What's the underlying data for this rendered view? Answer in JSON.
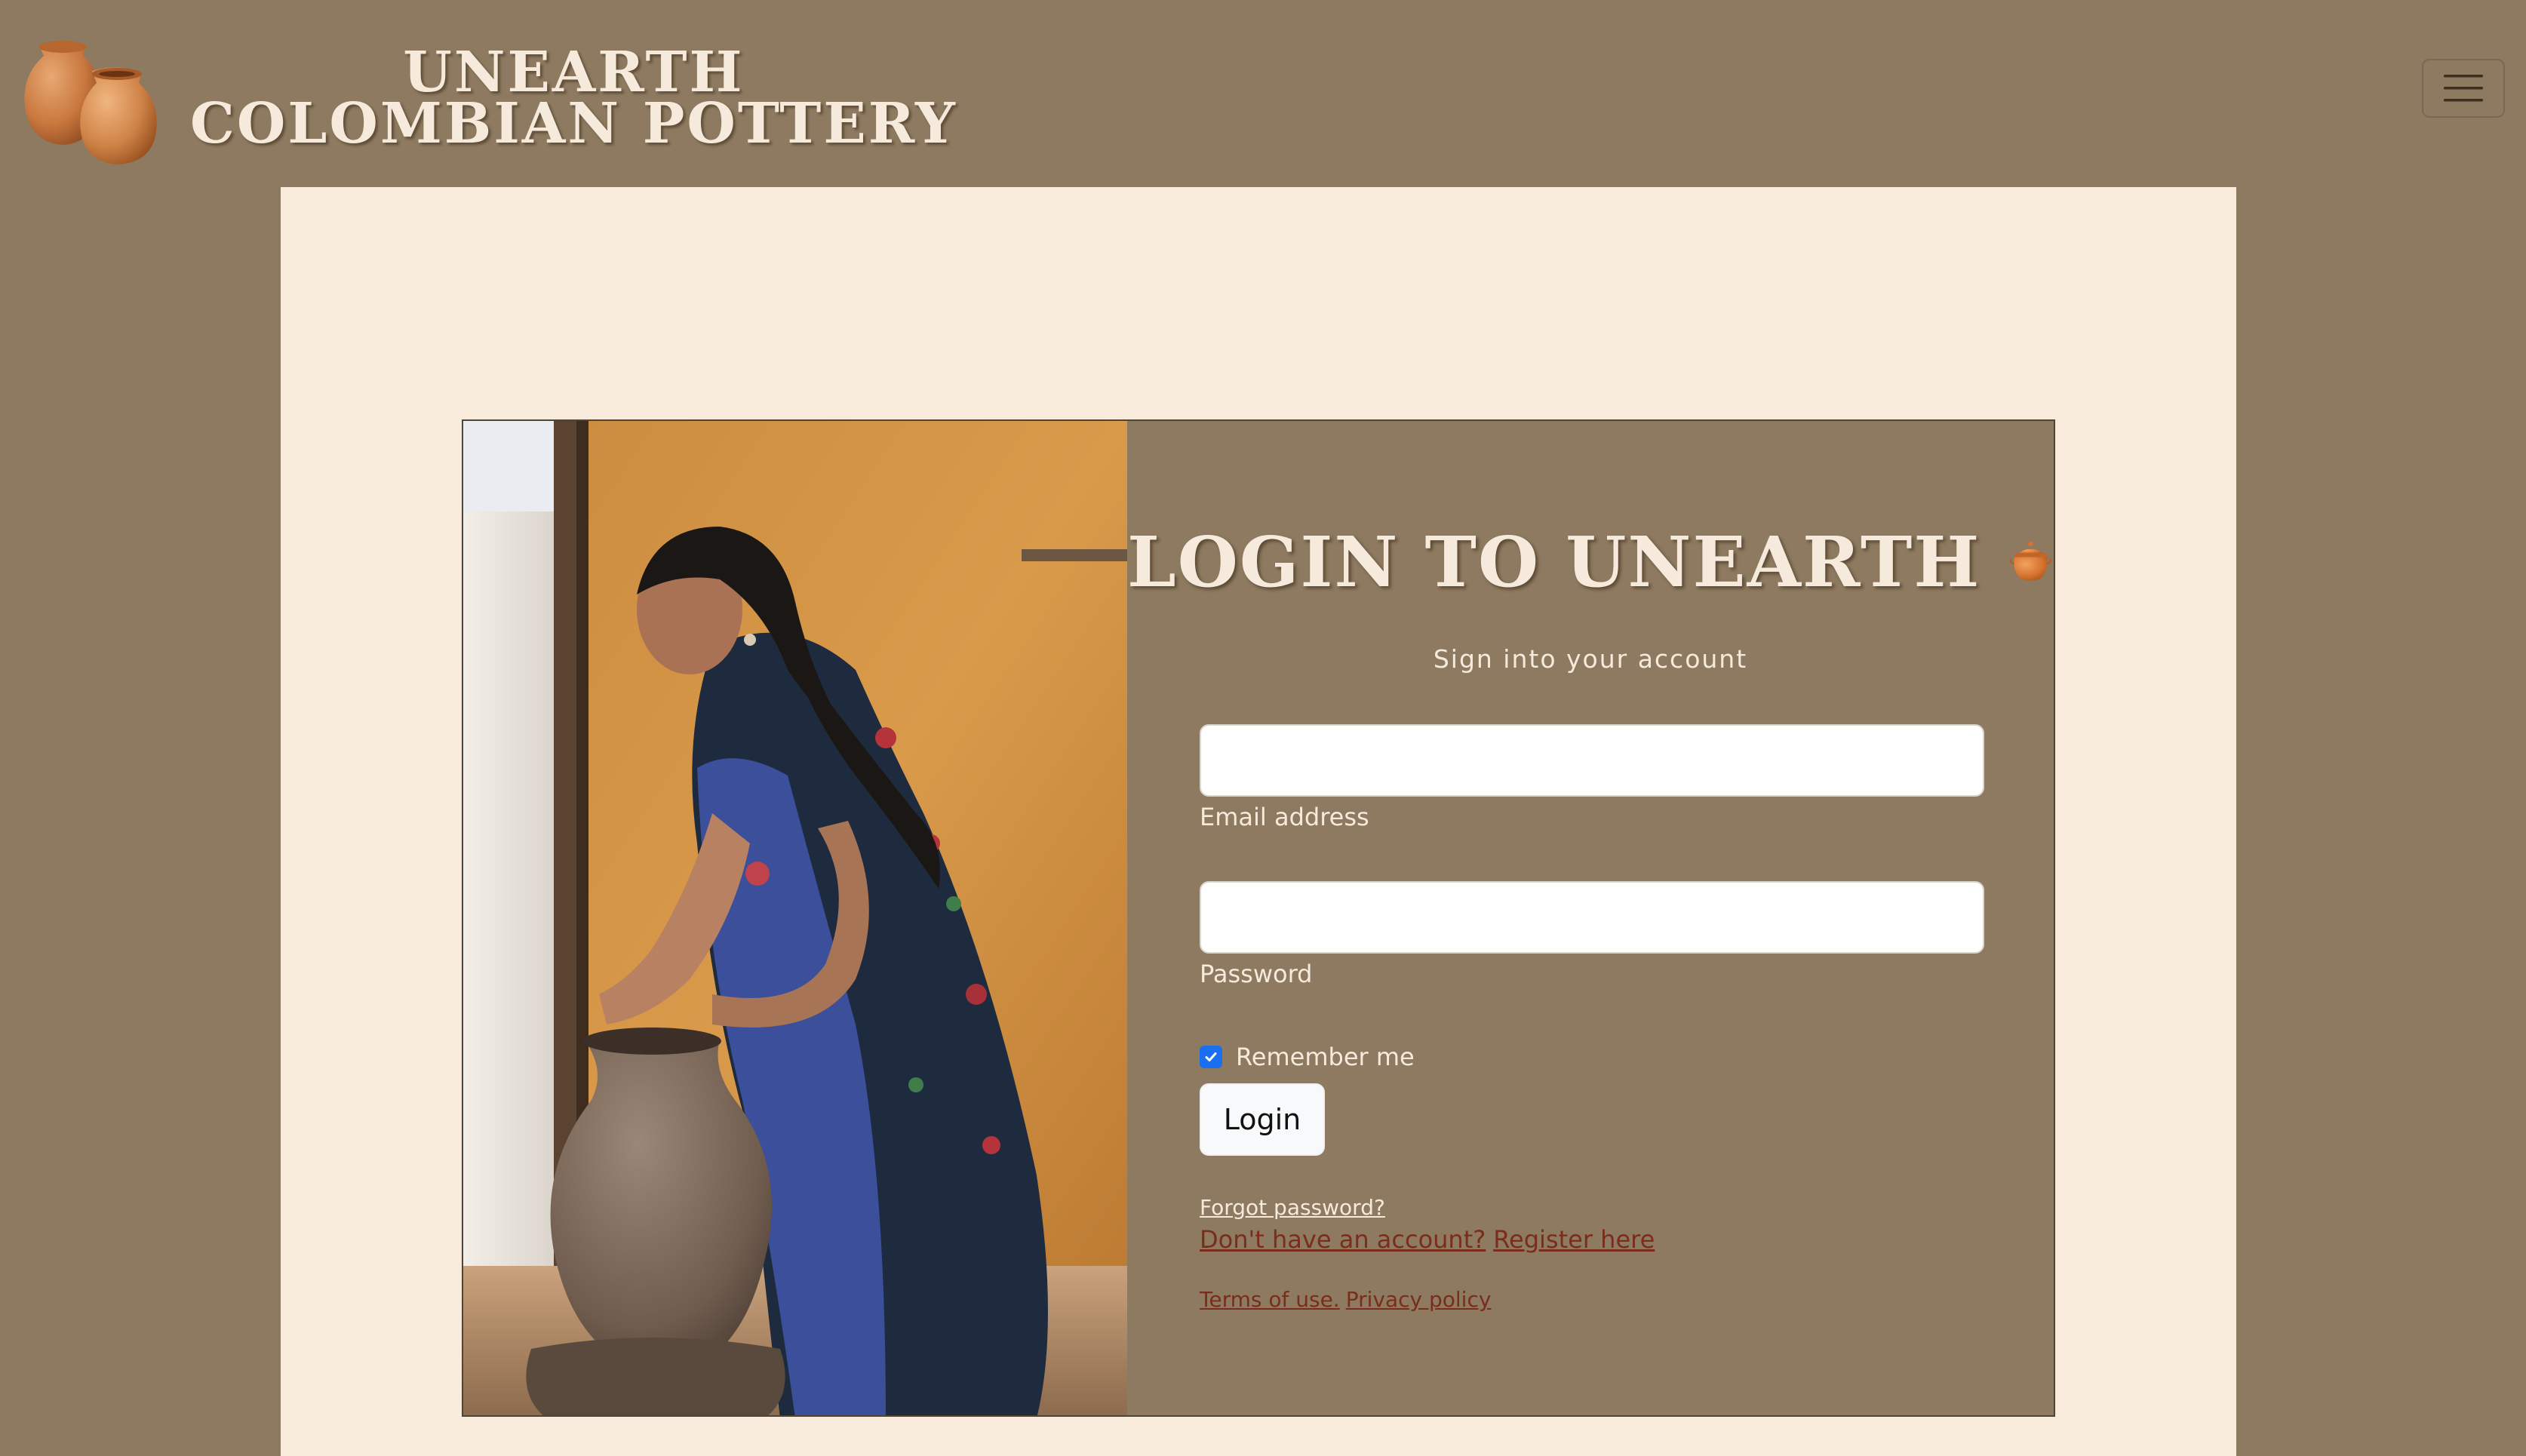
{
  "header": {
    "brand_line1": "UNEARTH",
    "brand_line2": "COLOMBIAN POTTERY",
    "logo_icon": "clay-pots-icon",
    "menu_icon": "hamburger-menu-icon"
  },
  "login": {
    "title": "LOGIN TO UNEARTH",
    "title_icon": "clay-pot-icon",
    "subtitle": "Sign into your account",
    "email": {
      "label": "Email address",
      "value": "",
      "placeholder": ""
    },
    "password": {
      "label": "Password",
      "value": "",
      "placeholder": ""
    },
    "remember_label": "Remember me",
    "remember_checked": true,
    "login_button": "Login",
    "forgot_link": "Forgot password?",
    "no_account_link": "Don't have an account?",
    "register_link": "Register here",
    "terms_link": "Terms of use.",
    "privacy_link": "Privacy policy"
  },
  "colors": {
    "background": "#8d7a60",
    "panel": "#f8ebdb",
    "text_light": "#f5eadb",
    "link_red": "#7a2d1a",
    "checkbox_blue": "#1a6ef0"
  }
}
